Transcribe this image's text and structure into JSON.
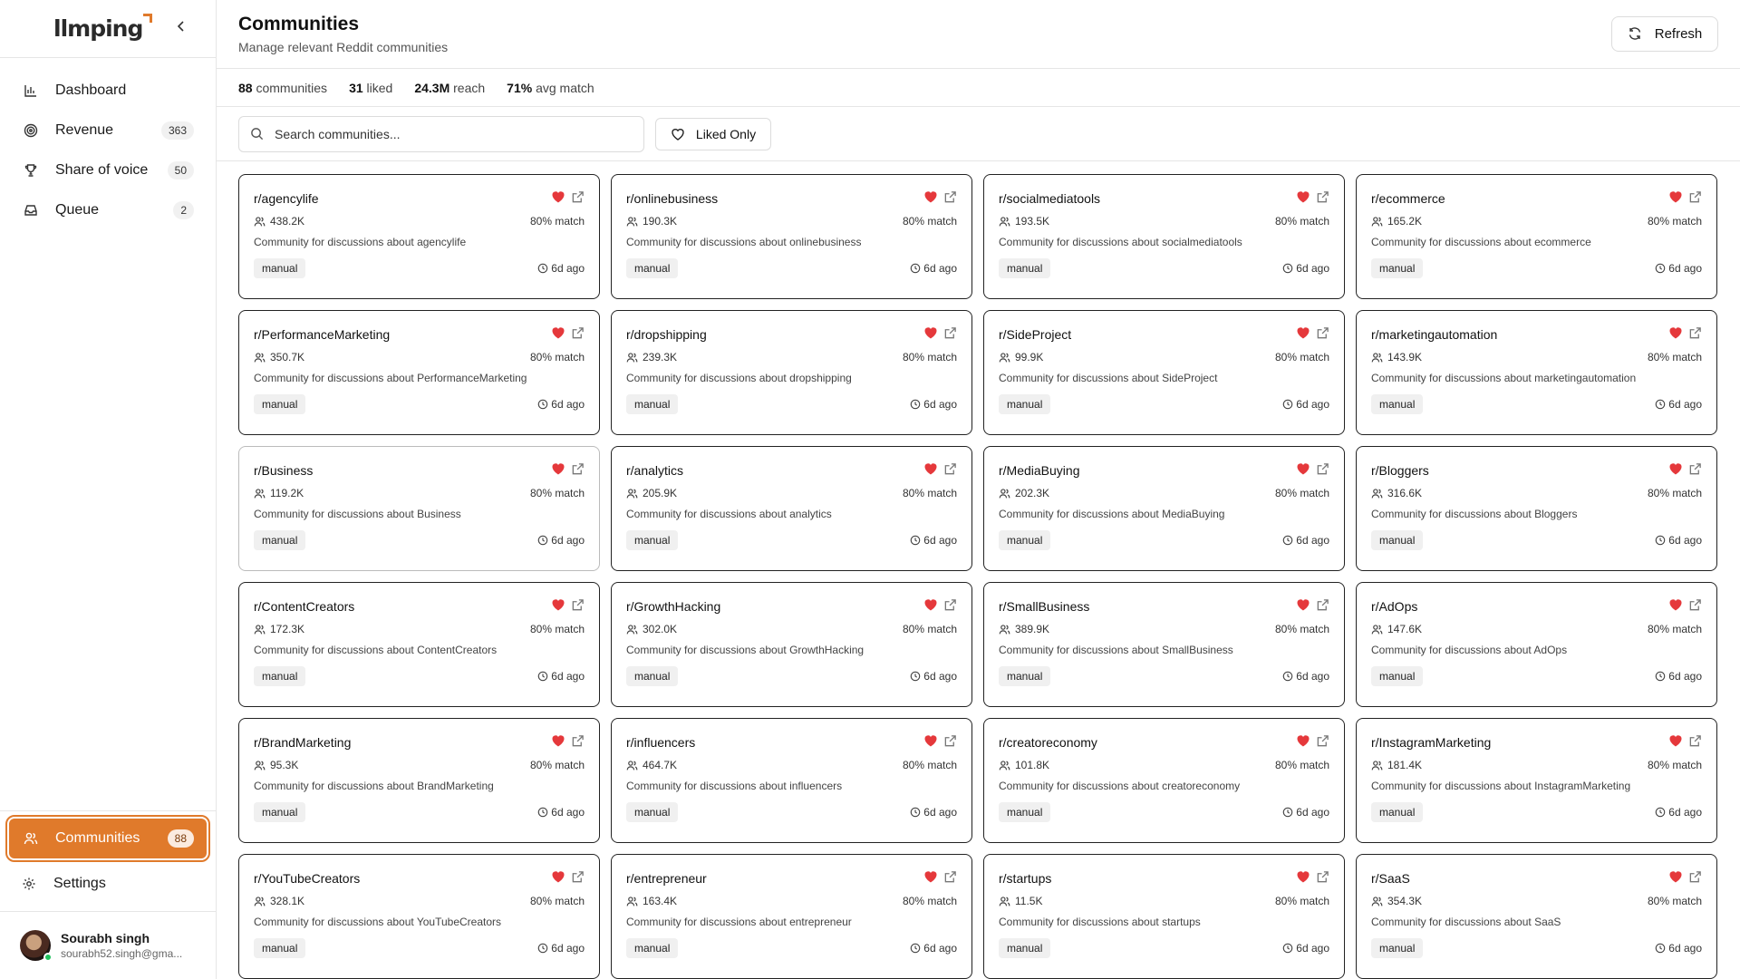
{
  "brand": {
    "name": "llmping",
    "accent": "#e07a2b"
  },
  "sidebar": {
    "collapse_icon": "chevron-left-icon",
    "items": [
      {
        "label": "Dashboard",
        "icon": "bar-chart-icon",
        "badge": ""
      },
      {
        "label": "Revenue",
        "icon": "target-icon",
        "badge": "363"
      },
      {
        "label": "Share of voice",
        "icon": "trophy-icon",
        "badge": "50"
      },
      {
        "label": "Queue",
        "icon": "inbox-icon",
        "badge": "2"
      }
    ],
    "bottom_items": [
      {
        "label": "Communities",
        "icon": "users-icon",
        "badge": "88",
        "active": true
      },
      {
        "label": "Settings",
        "icon": "gear-icon",
        "badge": ""
      }
    ],
    "user": {
      "name": "Sourabh singh",
      "email": "sourabh52.singh@gma...",
      "status": "online"
    }
  },
  "header": {
    "title": "Communities",
    "subtitle": "Manage relevant Reddit communities",
    "refresh_label": "Refresh"
  },
  "stats": {
    "communities_value": "88",
    "communities_label": "communities",
    "liked_value": "31",
    "liked_label": "liked",
    "reach_value": "24.3M",
    "reach_label": "reach",
    "match_value": "71%",
    "match_label": "avg match"
  },
  "toolbar": {
    "search_placeholder": "Search communities...",
    "liked_only_label": "Liked Only"
  },
  "colors": {
    "heart": "#e5383b",
    "text_muted": "#555555"
  },
  "communities": [
    {
      "name": "r/agencylife",
      "members": "438.2K",
      "match": "80% match",
      "desc": "Community for discussions about agencylife",
      "tag": "manual",
      "ago": "6d ago"
    },
    {
      "name": "r/onlinebusiness",
      "members": "190.3K",
      "match": "80% match",
      "desc": "Community for discussions about onlinebusiness",
      "tag": "manual",
      "ago": "6d ago"
    },
    {
      "name": "r/socialmediatools",
      "members": "193.5K",
      "match": "80% match",
      "desc": "Community for discussions about socialmediatools",
      "tag": "manual",
      "ago": "6d ago"
    },
    {
      "name": "r/ecommerce",
      "members": "165.2K",
      "match": "80% match",
      "desc": "Community for discussions about ecommerce",
      "tag": "manual",
      "ago": "6d ago"
    },
    {
      "name": "r/PerformanceMarketing",
      "members": "350.7K",
      "match": "80% match",
      "desc": "Community for discussions about PerformanceMarketing",
      "tag": "manual",
      "ago": "6d ago"
    },
    {
      "name": "r/dropshipping",
      "members": "239.3K",
      "match": "80% match",
      "desc": "Community for discussions about dropshipping",
      "tag": "manual",
      "ago": "6d ago"
    },
    {
      "name": "r/SideProject",
      "members": "99.9K",
      "match": "80% match",
      "desc": "Community for discussions about SideProject",
      "tag": "manual",
      "ago": "6d ago"
    },
    {
      "name": "r/marketingautomation",
      "members": "143.9K",
      "match": "80% match",
      "desc": "Community for discussions about marketingautomation",
      "tag": "manual",
      "ago": "6d ago"
    },
    {
      "name": "r/Business",
      "members": "119.2K",
      "match": "80% match",
      "desc": "Community for discussions about Business",
      "tag": "manual",
      "ago": "6d ago"
    },
    {
      "name": "r/analytics",
      "members": "205.9K",
      "match": "80% match",
      "desc": "Community for discussions about analytics",
      "tag": "manual",
      "ago": "6d ago"
    },
    {
      "name": "r/MediaBuying",
      "members": "202.3K",
      "match": "80% match",
      "desc": "Community for discussions about MediaBuying",
      "tag": "manual",
      "ago": "6d ago"
    },
    {
      "name": "r/Bloggers",
      "members": "316.6K",
      "match": "80% match",
      "desc": "Community for discussions about Bloggers",
      "tag": "manual",
      "ago": "6d ago"
    },
    {
      "name": "r/ContentCreators",
      "members": "172.3K",
      "match": "80% match",
      "desc": "Community for discussions about ContentCreators",
      "tag": "manual",
      "ago": "6d ago"
    },
    {
      "name": "r/GrowthHacking",
      "members": "302.0K",
      "match": "80% match",
      "desc": "Community for discussions about GrowthHacking",
      "tag": "manual",
      "ago": "6d ago"
    },
    {
      "name": "r/SmallBusiness",
      "members": "389.9K",
      "match": "80% match",
      "desc": "Community for discussions about SmallBusiness",
      "tag": "manual",
      "ago": "6d ago"
    },
    {
      "name": "r/AdOps",
      "members": "147.6K",
      "match": "80% match",
      "desc": "Community for discussions about AdOps",
      "tag": "manual",
      "ago": "6d ago"
    },
    {
      "name": "r/BrandMarketing",
      "members": "95.3K",
      "match": "80% match",
      "desc": "Community for discussions about BrandMarketing",
      "tag": "manual",
      "ago": "6d ago"
    },
    {
      "name": "r/influencers",
      "members": "464.7K",
      "match": "80% match",
      "desc": "Community for discussions about influencers",
      "tag": "manual",
      "ago": "6d ago"
    },
    {
      "name": "r/creatoreconomy",
      "members": "101.8K",
      "match": "80% match",
      "desc": "Community for discussions about creatoreconomy",
      "tag": "manual",
      "ago": "6d ago"
    },
    {
      "name": "r/InstagramMarketing",
      "members": "181.4K",
      "match": "80% match",
      "desc": "Community for discussions about InstagramMarketing",
      "tag": "manual",
      "ago": "6d ago"
    },
    {
      "name": "r/YouTubeCreators",
      "members": "328.1K",
      "match": "80% match",
      "desc": "Community for discussions about YouTubeCreators",
      "tag": "manual",
      "ago": "6d ago"
    },
    {
      "name": "r/entrepreneur",
      "members": "163.4K",
      "match": "80% match",
      "desc": "Community for discussions about entrepreneur",
      "tag": "manual",
      "ago": "6d ago"
    },
    {
      "name": "r/startups",
      "members": "11.5K",
      "match": "80% match",
      "desc": "Community for discussions about startups",
      "tag": "manual",
      "ago": "6d ago"
    },
    {
      "name": "r/SaaS",
      "members": "354.3K",
      "match": "80% match",
      "desc": "Community for discussions about SaaS",
      "tag": "manual",
      "ago": "6d ago"
    }
  ]
}
